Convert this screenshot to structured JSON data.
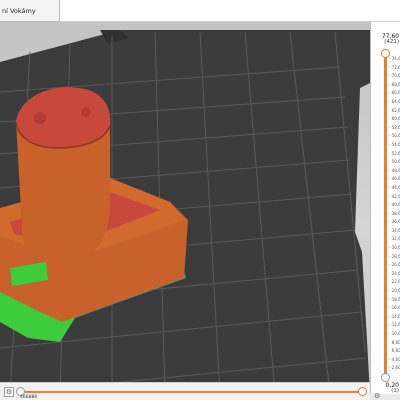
{
  "tab": {
    "title": "ní Vokámy"
  },
  "vertical_slider": {
    "top_value": "77,60",
    "top_layer": "(421)",
    "bottom_value": "0,20",
    "bottom_layer": "(1)",
    "ticks": [
      "74,60",
      "72,60",
      "70,60",
      "68,60",
      "66,60",
      "64,60",
      "62,60",
      "60,60",
      "58,60",
      "56,60",
      "54,60",
      "52,60",
      "50,60",
      "48,60",
      "46,60",
      "44,60",
      "42,60",
      "40,60",
      "38,60",
      "36,60",
      "34,60",
      "32,60",
      "30,60",
      "28,60",
      "26,60",
      "24,60",
      "22,60",
      "20,60",
      "18,60",
      "16,60",
      "14,60",
      "12,60",
      "10,60",
      "8,60",
      "6,60",
      "4,60",
      "2,60"
    ],
    "settings_icon": "gear-icon"
  },
  "horizontal_slider": {
    "left_value": "466886",
    "right_value": "469710",
    "icon": "cog-icon"
  },
  "colors": {
    "accent": "#ea7f34",
    "bed": "#3b3b3b",
    "grid": "#5a5a5a",
    "perimeter": "#c8612a",
    "infill": "#c9483c",
    "support": "#3ccc3c",
    "viewport_bg": "#cbcbcb"
  }
}
